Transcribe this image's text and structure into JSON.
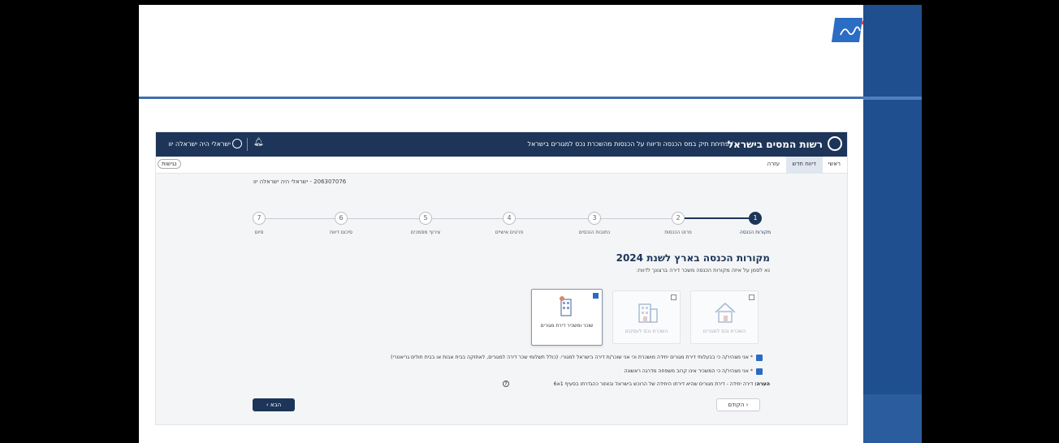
{
  "header": {
    "brand": "רשות המסים בישראל",
    "breadcrumb": "/ פתיחת תיק במס הכנסה ודיווח על הכנסות מהשכרת נכס למגורים בישראל",
    "user_name": "ישראלי היה ישראלה יוו"
  },
  "nav": {
    "home": "ראשי",
    "new_report": "דיווח חדש",
    "help": "עזרה",
    "accessibility": "נגישות"
  },
  "taxpayer": "206307076 - ישראלי היה ישראלה יוו",
  "steps": [
    {
      "num": "1",
      "label": "מקורות הכנסה"
    },
    {
      "num": "2",
      "label": "פרוט הכנסות"
    },
    {
      "num": "3",
      "label": "כתובות הנכסים"
    },
    {
      "num": "4",
      "label": "פרטים אישיים"
    },
    {
      "num": "5",
      "label": "צירוף מסמכים"
    },
    {
      "num": "6",
      "label": "סיכום דיווח"
    },
    {
      "num": "7",
      "label": "סיום"
    }
  ],
  "section": {
    "title": "מקורות הכנסה בארץ לשנת 2024",
    "subtitle": "נא לסמן על איזה מקורות הכנסה משכר דירה ברצונך לדווח:"
  },
  "options": [
    {
      "label": "השכרת נכס למגורים",
      "checked": false
    },
    {
      "label": "השכרת נכס לעסקים",
      "checked": false
    },
    {
      "label": "שוכר ומשכיר דירת מגורים",
      "checked": true
    }
  ],
  "declarations": [
    "אני מצהיר/ה כי בבעלותי דירת מגורים יחידה מושכרת וכי אני שוכר/ת דירה בישראל למגורי. (כולל תשלומי שכר דירה למגורים, לאחזקה בבית אבות או בבית חולים גריאטרי)",
    "אני מצהיר/ה כי המשכיר אינו קרוב משפחה מדרגה ראשונה"
  ],
  "note_label": "הערה:",
  "note_text": "דירה יחידה - דירת מגורים שהיא דירתו היחידה של הרוכש בישראל ובאזור כהגדרתו בסעיף 1א6",
  "buttons": {
    "next": "הבא",
    "prev": "הקודם"
  },
  "colors": {
    "primary": "#1c3558",
    "accent": "#2a6bc4"
  }
}
